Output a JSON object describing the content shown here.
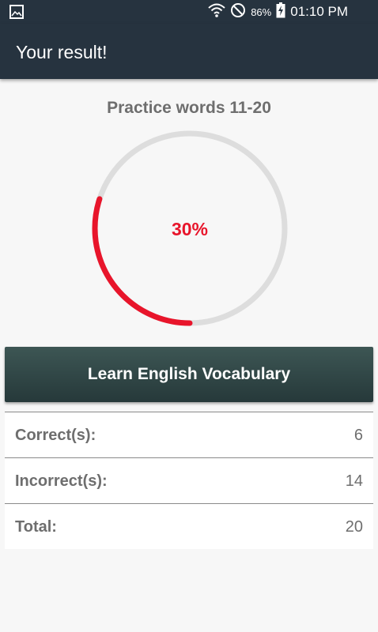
{
  "status_bar": {
    "battery_percent": "86%",
    "time": "01:10 PM",
    "icons": [
      "gallery-icon",
      "wifi-icon",
      "do-not-disturb-icon",
      "battery-charging-icon"
    ]
  },
  "app_bar": {
    "title": "Your result!"
  },
  "result": {
    "practice_title": "Practice words 11-20",
    "percent_label": "30%",
    "progress_fraction": 0.3,
    "progress_color": "#e8152b",
    "track_color": "#dddddd"
  },
  "learn_button": {
    "label": "Learn English Vocabulary"
  },
  "stats": {
    "rows": [
      {
        "label": "Correct(s):",
        "value": "6"
      },
      {
        "label": "Incorrect(s):",
        "value": "14"
      },
      {
        "label": "Total:",
        "value": "20"
      }
    ]
  },
  "colors": {
    "app_bar": "#26333f",
    "button_top": "#3d5654",
    "button_bottom": "#26393a",
    "text_gray": "#6e6e6e"
  }
}
